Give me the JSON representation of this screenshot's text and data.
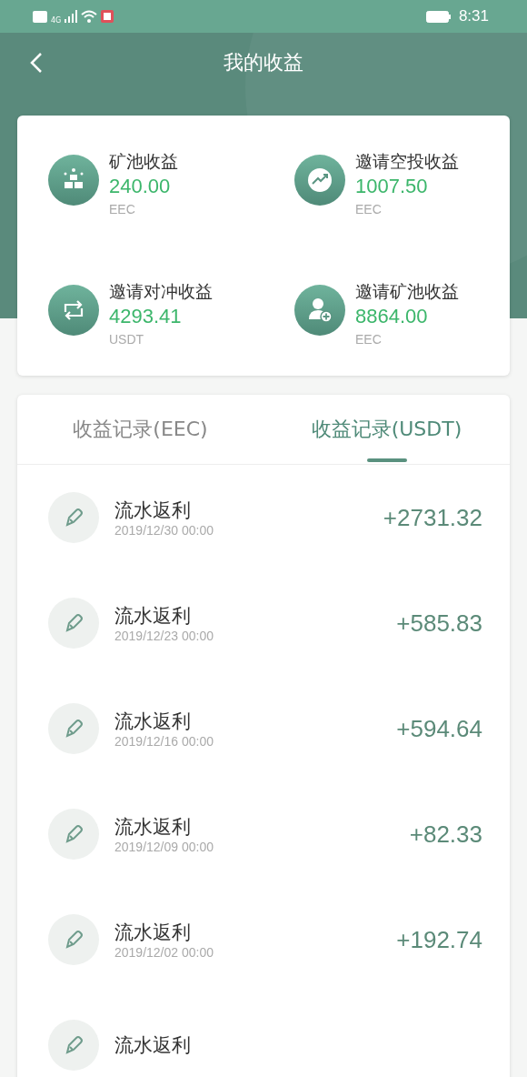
{
  "status_bar": {
    "time": "8:31",
    "network": "4G"
  },
  "header": {
    "title": "我的收益"
  },
  "summary": [
    {
      "kind": "gold",
      "label": "矿池收益",
      "value": "240.00",
      "unit": "EEC"
    },
    {
      "kind": "trend",
      "label": "邀请空投收益",
      "value": "1007.50",
      "unit": "EEC"
    },
    {
      "kind": "exchange",
      "label": "邀请对冲收益",
      "value": "4293.41",
      "unit": "USDT"
    },
    {
      "kind": "user-add",
      "label": "邀请矿池收益",
      "value": "8864.00",
      "unit": "EEC"
    }
  ],
  "tabs": [
    {
      "label": "收益记录(EEC)",
      "selected": false
    },
    {
      "label": "收益记录(USDT)",
      "selected": true
    }
  ],
  "records": [
    {
      "title": "流水返利",
      "date": "2019/12/30 00:00",
      "amount": "+2731.32"
    },
    {
      "title": "流水返利",
      "date": "2019/12/23 00:00",
      "amount": "+585.83"
    },
    {
      "title": "流水返利",
      "date": "2019/12/16 00:00",
      "amount": "+594.64"
    },
    {
      "title": "流水返利",
      "date": "2019/12/09 00:00",
      "amount": "+82.33"
    },
    {
      "title": "流水返利",
      "date": "2019/12/02 00:00",
      "amount": "+192.74"
    },
    {
      "title": "流水返利"
    }
  ]
}
